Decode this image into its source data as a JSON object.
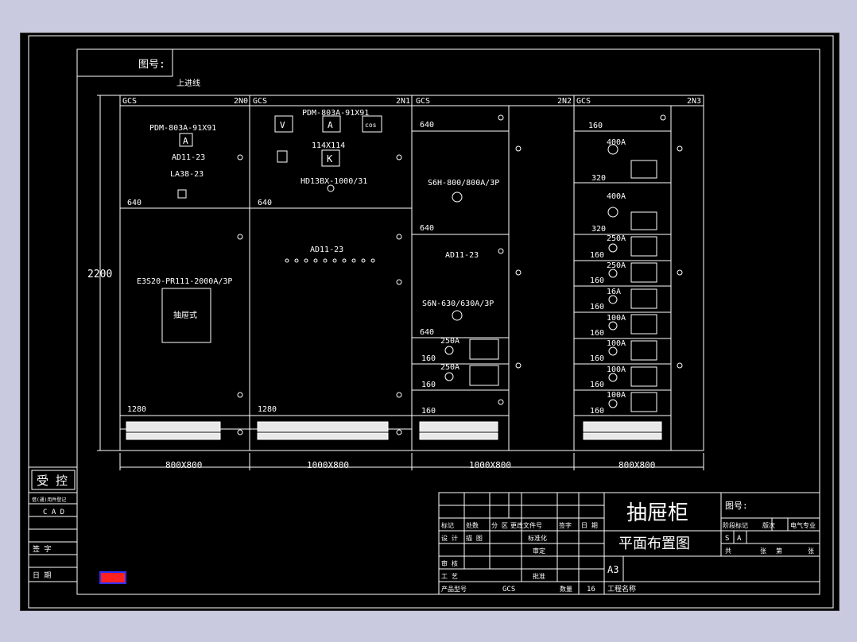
{
  "sheet": {
    "ref_label": "图号:",
    "incoming_label": "上进线",
    "total_height": "2200"
  },
  "panels": [
    {
      "type": "GCS",
      "code": "2N0",
      "size": "800X800",
      "top": {
        "meter_model": "PDM-803A-91X91",
        "meter_symbol": "A",
        "lamp": "AD11-23",
        "button": "LA38-23",
        "height": "640"
      },
      "middle": {
        "breaker": "E3S20-PR111-2000A/3P",
        "drawer_label": "抽屉式",
        "height": "1280"
      }
    },
    {
      "type": "GCS",
      "code": "2N1",
      "size": "1000X800",
      "top": {
        "meter_model": "PDM-803A-91X91",
        "meter_v": "V",
        "meter_a": "A",
        "meter_cos": "cos",
        "meter_size": "114X114",
        "meter_k": "K",
        "switch": "HD13BX-1000/31",
        "height": "640"
      },
      "middle": {
        "lamp": "AD11-23",
        "height": "1280"
      }
    },
    {
      "type": "GCS",
      "code": "2N2",
      "size": "1000X800",
      "cells": [
        {
          "height": "640"
        },
        {
          "breaker": "S6H-800/800A/3P",
          "height": "640"
        },
        {
          "lamp": "AD11-23",
          "breaker": "S6N-630/630A/3P",
          "height": "640"
        },
        {
          "rating": "250A",
          "height": "160"
        },
        {
          "rating": "250A",
          "height": "160"
        },
        {
          "height": "160"
        }
      ]
    },
    {
      "type": "GCS",
      "code": "2N3",
      "size": "800X800",
      "cells": [
        {
          "height": "160"
        },
        {
          "rating": "400A",
          "height": "320"
        },
        {
          "rating": "400A",
          "height": "320"
        },
        {
          "rating": "250A",
          "height": "160"
        },
        {
          "rating": "250A",
          "height": "160"
        },
        {
          "rating": "16A",
          "height": "160"
        },
        {
          "rating": "100A",
          "height": "160"
        },
        {
          "rating": "100A",
          "height": "160"
        },
        {
          "rating": "100A",
          "height": "160"
        },
        {
          "rating": "100A",
          "height": "160"
        }
      ]
    }
  ],
  "left_block": {
    "stamp": "受 控",
    "reg_label": "借(通)用件登记",
    "cad": "C A D",
    "sign_label": "签    字",
    "date_label": "日    期"
  },
  "title_block": {
    "title": "抽屉柜",
    "subtitle": "平面布置图",
    "drawing_no_label": "图号:",
    "header_cells": [
      "标记",
      "处数",
      "分 区",
      "更改文件号",
      "签字",
      "日 期"
    ],
    "design_label": "设 计",
    "drawn_label": "描 图",
    "std_label": "标准化",
    "review_label": "审定",
    "check_label": "审 核",
    "process_label": "工 艺",
    "approve_label": "批准",
    "model_label": "产品型号",
    "model_value": "GCS",
    "qty_label": "数量",
    "qty_value": "16",
    "project_label": "工程名称",
    "paper_size": "A3",
    "stage_label": "阶段标记",
    "version_label": "版次",
    "discipline_label": "电气专业",
    "stage_s": "S",
    "stage_a": "A",
    "total_label": "共",
    "sheets_label": "张",
    "sheet_label": "第",
    "page_label": "张"
  },
  "colors": {
    "background": "#000000",
    "line": "#ffffff",
    "app_bg": "#c9c9e0",
    "marker_red": "#ff2020",
    "marker_blue": "#3030ff"
  }
}
